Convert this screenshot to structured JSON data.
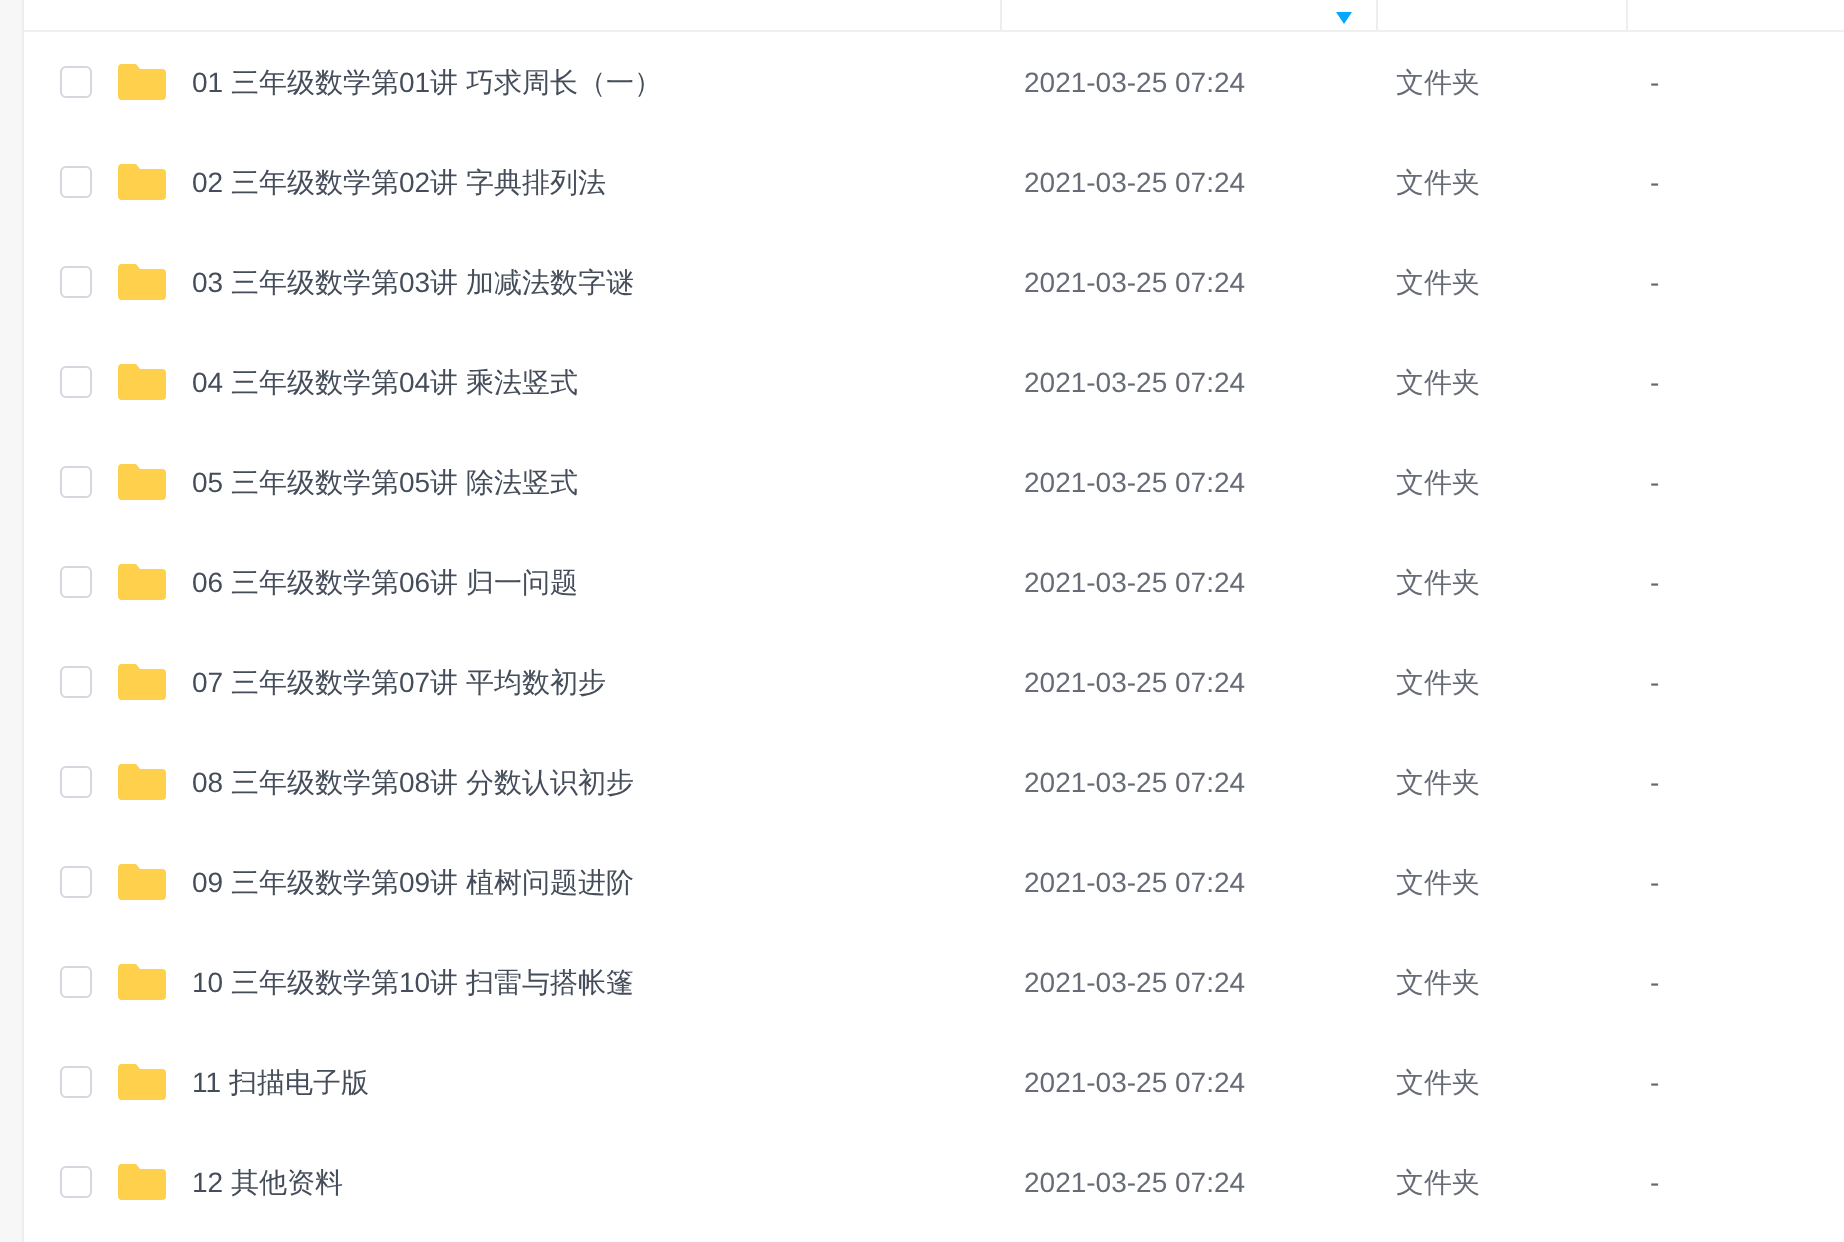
{
  "rows": [
    {
      "name": "01 三年级数学第01讲 巧求周长（一）",
      "modified": "2021-03-25 07:24",
      "type": "文件夹",
      "size": "-",
      "checked": false
    },
    {
      "name": "02 三年级数学第02讲 字典排列法",
      "modified": "2021-03-25 07:24",
      "type": "文件夹",
      "size": "-",
      "checked": false
    },
    {
      "name": "03 三年级数学第03讲 加减法数字谜",
      "modified": "2021-03-25 07:24",
      "type": "文件夹",
      "size": "-",
      "checked": false
    },
    {
      "name": "04 三年级数学第04讲 乘法竖式",
      "modified": "2021-03-25 07:24",
      "type": "文件夹",
      "size": "-",
      "checked": false
    },
    {
      "name": "05 三年级数学第05讲 除法竖式",
      "modified": "2021-03-25 07:24",
      "type": "文件夹",
      "size": "-",
      "checked": false
    },
    {
      "name": "06 三年级数学第06讲 归一问题",
      "modified": "2021-03-25 07:24",
      "type": "文件夹",
      "size": "-",
      "checked": false
    },
    {
      "name": "07 三年级数学第07讲 平均数初步",
      "modified": "2021-03-25 07:24",
      "type": "文件夹",
      "size": "-",
      "checked": false
    },
    {
      "name": "08 三年级数学第08讲 分数认识初步",
      "modified": "2021-03-25 07:24",
      "type": "文件夹",
      "size": "-",
      "checked": false
    },
    {
      "name": "09 三年级数学第09讲 植树问题进阶",
      "modified": "2021-03-25 07:24",
      "type": "文件夹",
      "size": "-",
      "checked": false
    },
    {
      "name": "10 三年级数学第10讲 扫雷与搭帐篷",
      "modified": "2021-03-25 07:24",
      "type": "文件夹",
      "size": "-",
      "checked": false
    },
    {
      "name": "11 扫描电子版",
      "modified": "2021-03-25 07:24",
      "type": "文件夹",
      "size": "-",
      "checked": false
    },
    {
      "name": "12 其他资料",
      "modified": "2021-03-25 07:24",
      "type": "文件夹",
      "size": "-",
      "checked": false
    }
  ]
}
